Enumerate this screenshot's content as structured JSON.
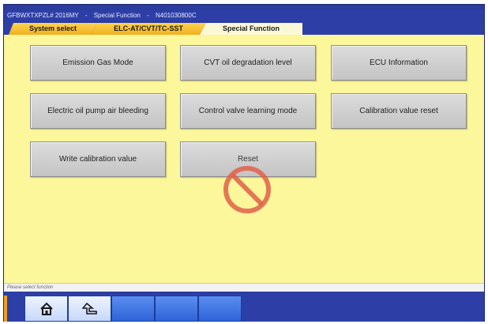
{
  "window": {
    "title_parts": [
      "GFBWXTXPZL# 2016MY",
      "Special Function",
      "N401030800C"
    ],
    "title_sep": "-"
  },
  "tabs": [
    {
      "label": "System select",
      "state": "inactive"
    },
    {
      "label": "ELC-AT/CVT/TC-SST",
      "state": "inactive"
    },
    {
      "label": "Special Function",
      "state": "active"
    }
  ],
  "functions": [
    {
      "label": "Emission Gas Mode"
    },
    {
      "label": "CVT oil degradation level"
    },
    {
      "label": "ECU Information"
    },
    {
      "label": "Electric oil pump air bleeding"
    },
    {
      "label": "Control valve learning mode"
    },
    {
      "label": "Calibration value reset"
    },
    {
      "label": "Write calibration value"
    },
    {
      "label": "Reset",
      "disabled": true
    }
  ],
  "status": {
    "message": "Please select function"
  },
  "toolbar": {
    "buttons": [
      {
        "icon": "home-icon"
      },
      {
        "icon": "back-arrow-icon"
      },
      {
        "icon": ""
      },
      {
        "icon": ""
      },
      {
        "icon": ""
      }
    ]
  },
  "colors": {
    "content_bg": "#fbf79a",
    "frame_blue": "#2d3fa6",
    "tab_orange": "#f0b020",
    "no_sign_red": "#e0604a"
  }
}
